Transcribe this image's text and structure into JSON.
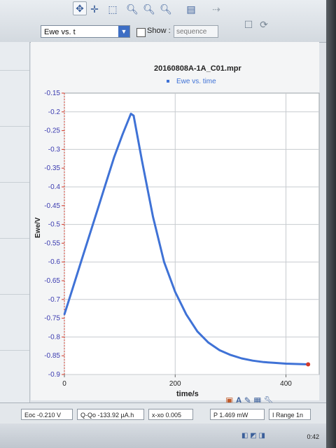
{
  "toolbar": {
    "series_select_value": "Ewe vs. t",
    "show_label": "Show :",
    "sequence_select_value": "sequence"
  },
  "chart_data": {
    "type": "line",
    "title": "20160808A-1A_C01.mpr",
    "legend": [
      "Ewe vs. time"
    ],
    "xlabel": "time/s",
    "ylabel": "Ewe/V",
    "xlim": [
      0,
      460
    ],
    "ylim": [
      -0.9,
      -0.15
    ],
    "xticks": [
      "0",
      "200",
      "400"
    ],
    "yticks": [
      "-0.15",
      "-0.2",
      "-0.25",
      "-0.3",
      "-0.35",
      "-0.4",
      "-0.45",
      "-0.5",
      "-0.55",
      "-0.6",
      "-0.65",
      "-0.7",
      "-0.75",
      "-0.8",
      "-0.85",
      "-0.9"
    ],
    "grid": true,
    "series": [
      {
        "name": "Ewe vs. time",
        "color": "#3f72d6",
        "x": [
          0,
          15,
          30,
          45,
          60,
          75,
          90,
          105,
          120,
          125,
          140,
          160,
          180,
          200,
          220,
          240,
          260,
          280,
          300,
          320,
          340,
          360,
          380,
          400,
          420,
          440
        ],
        "y": [
          -0.74,
          -0.67,
          -0.6,
          -0.53,
          -0.46,
          -0.39,
          -0.32,
          -0.26,
          -0.205,
          -0.21,
          -0.33,
          -0.48,
          -0.6,
          -0.68,
          -0.74,
          -0.785,
          -0.815,
          -0.835,
          -0.848,
          -0.857,
          -0.863,
          -0.867,
          -0.869,
          -0.871,
          -0.872,
          -0.873
        ]
      }
    ],
    "end_marker_color": "#d23a2a"
  },
  "status": {
    "eoc": "Eoc  -0.210 V",
    "qqo": "Q-Qo  -133.92 µA.h",
    "xxo": "x-xo  0.005",
    "p": "P  1.469 mW",
    "range": "I Range  1n"
  },
  "taskbar": {
    "clock": "0:42"
  }
}
